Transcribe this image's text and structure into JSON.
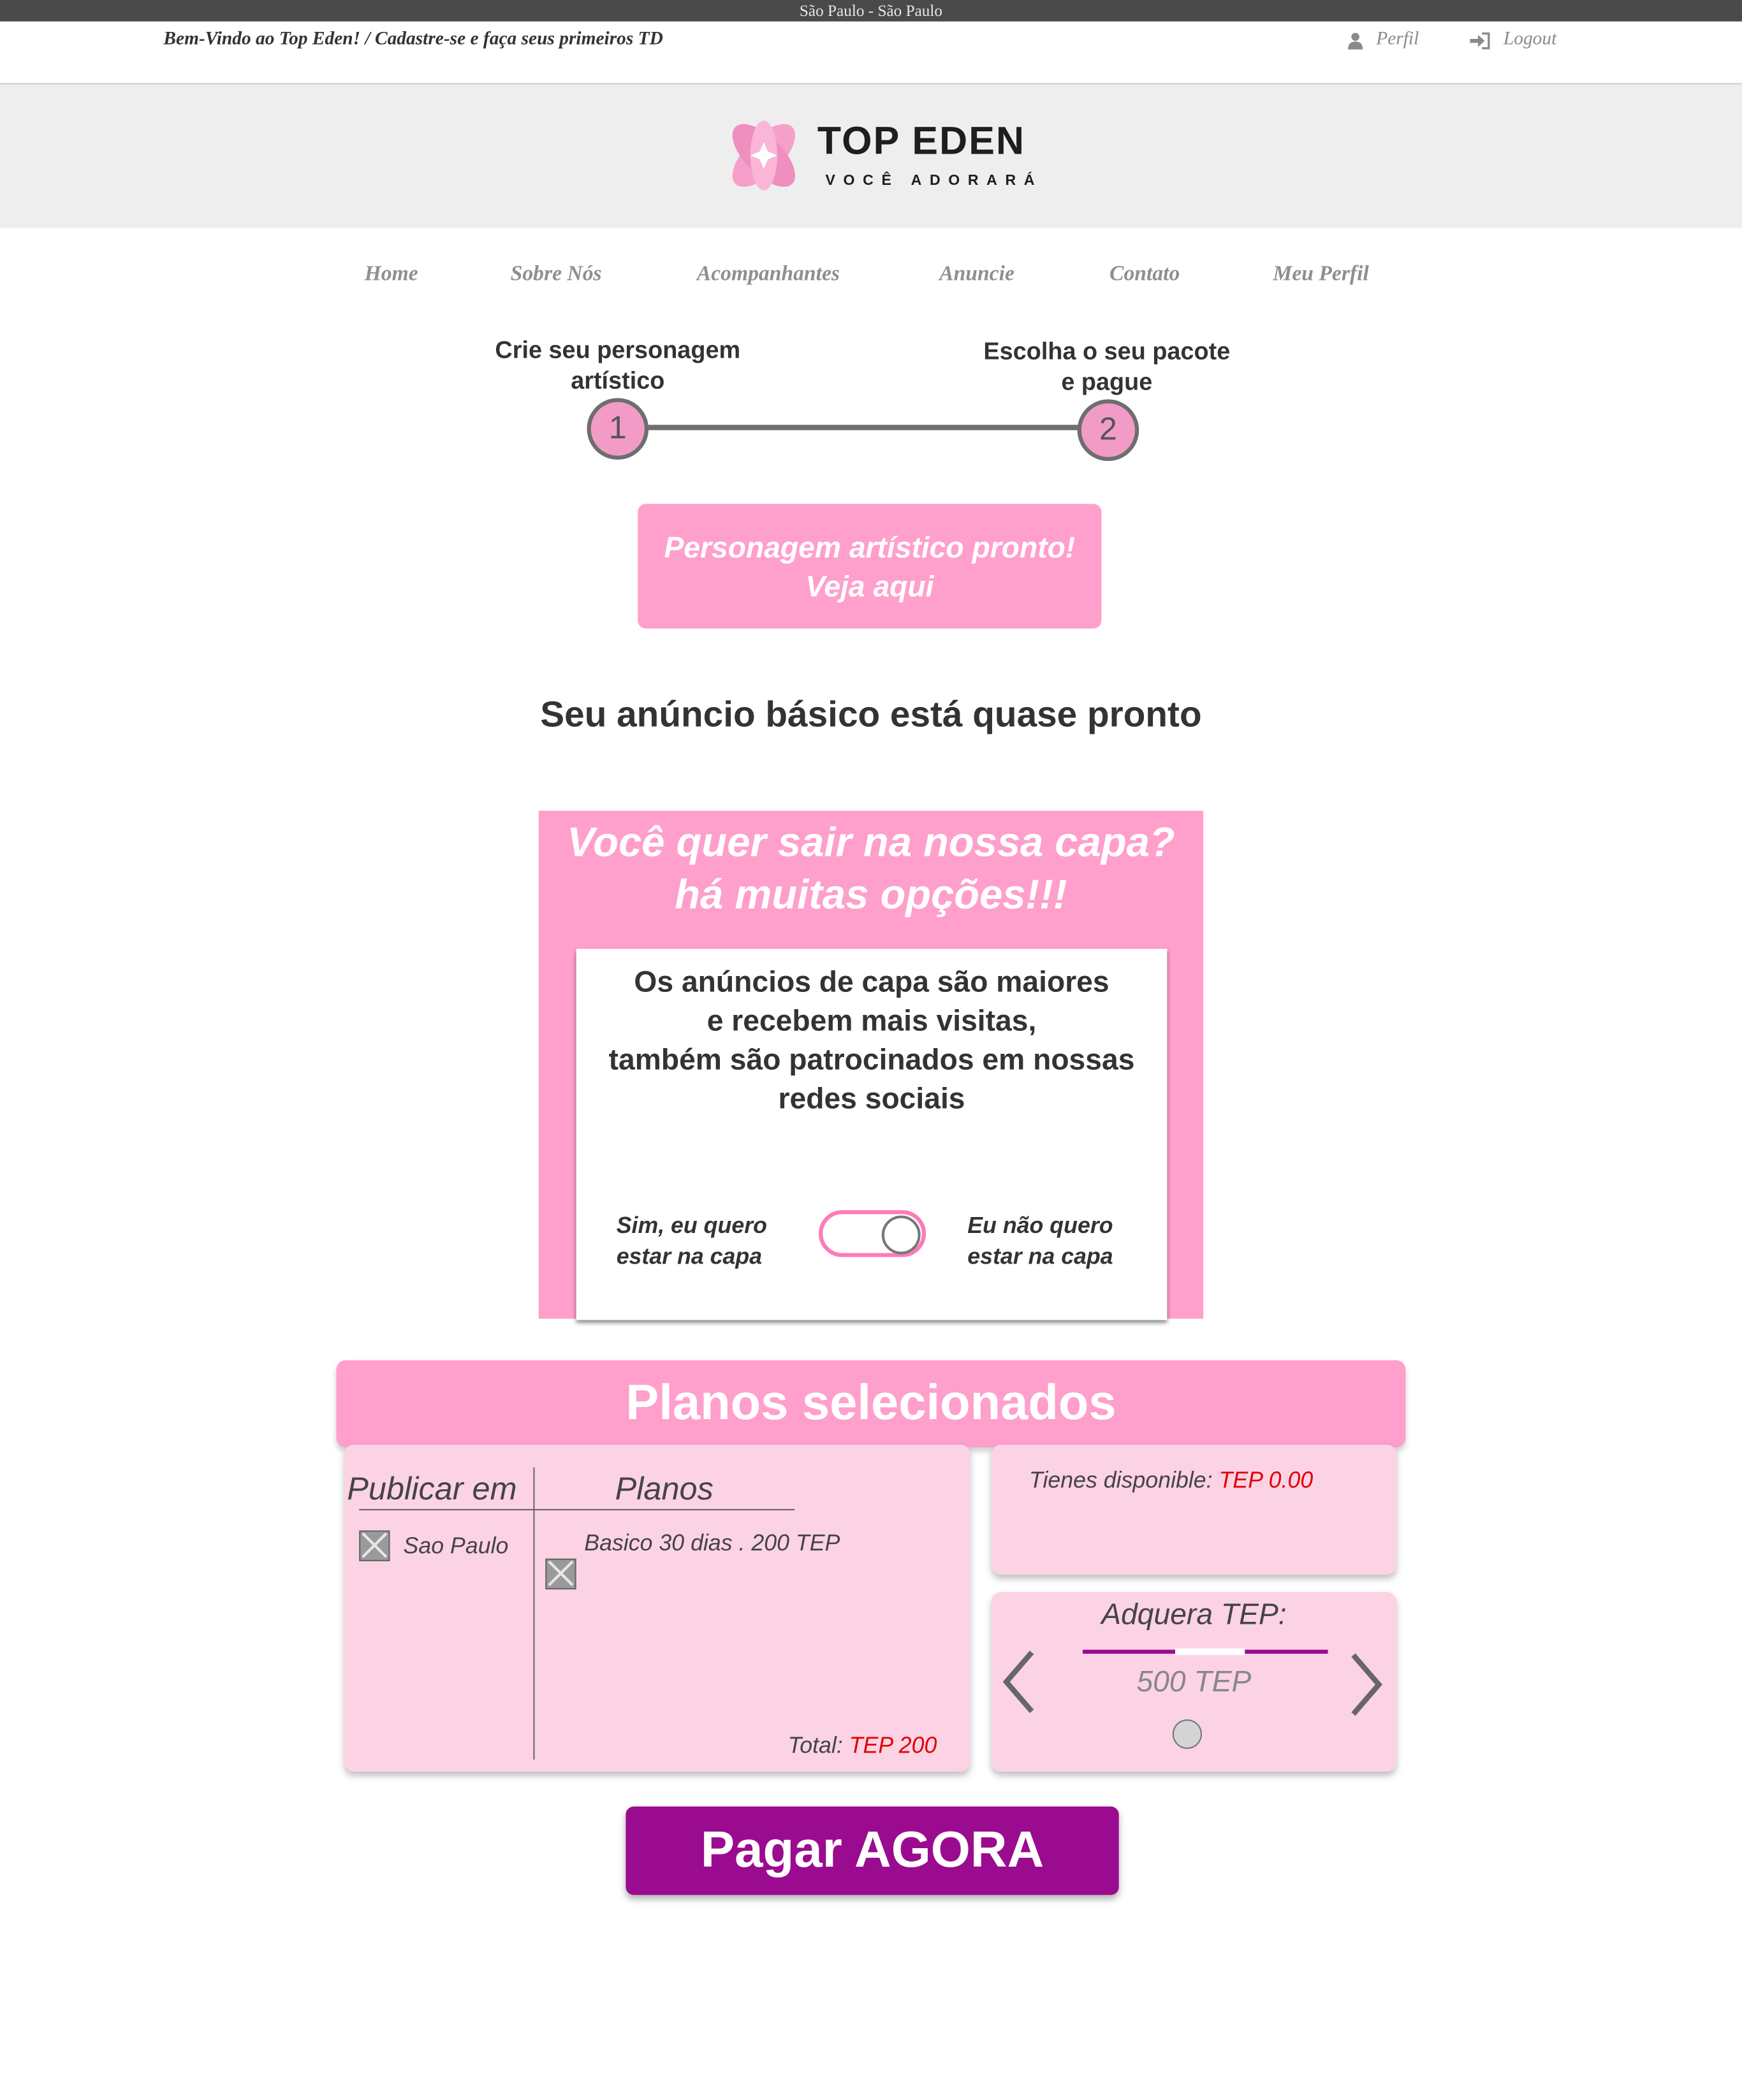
{
  "topbar": {
    "location": "São Paulo - São Paulo"
  },
  "header": {
    "welcome": "Bem-Vindo ao Top Eden! / Cadastre-se e faça seus primeiros TD",
    "perfil_label": "Perfil",
    "logout_label": "Logout"
  },
  "logo": {
    "name": "TOP EDEN",
    "tagline": "VOCÊ ADORARÁ"
  },
  "nav": {
    "items": [
      {
        "label": "Home"
      },
      {
        "label": "Sobre Nós"
      },
      {
        "label": "Acompanhantes"
      },
      {
        "label": "Anuncie"
      },
      {
        "label": "Contato"
      },
      {
        "label": "Meu Perfil"
      }
    ]
  },
  "steps": [
    {
      "number": "1",
      "line1": "Crie seu personagem",
      "line2": "artístico"
    },
    {
      "number": "2",
      "line1": "Escolha o seu pacote",
      "line2": "e pague"
    }
  ],
  "ready_button": {
    "line1": "Personagem artístico pronto!",
    "line2": "Veja aqui"
  },
  "almost_title": "Seu anúncio básico está quase pronto",
  "capa": {
    "title_line1": "Você quer sair na nossa capa?",
    "title_line2": "há muitas opções!!!",
    "desc_line1": "Os anúncios de capa são maiores",
    "desc_line2": "e recebem mais visitas,",
    "desc_line3": "também são patrocinados em nossas",
    "desc_line4": "redes sociais",
    "yes_line1": "Sim, eu quero",
    "yes_line2": "estar na capa",
    "no_line1": "Eu não quero",
    "no_line2": "estar na capa"
  },
  "plans": {
    "header": "Planos selecionados",
    "col_publish": "Publicar em",
    "col_plans": "Planos",
    "publish_item": "Sao Paulo",
    "plan_item": "Basico 30 dias . 200 TEP",
    "total_label": "Total:",
    "total_value": "TEP  200"
  },
  "balance": {
    "label": "Tienes disponible:",
    "value": "TEP 0.00"
  },
  "buy": {
    "title": "Adquera TEP:",
    "amount": "500 TEP"
  },
  "pay_button": "Pagar AGORA",
  "colors": {
    "pink": "#ff9fcb",
    "light_pink": "#fcd3e5",
    "purple": "#9b0b8f",
    "red": "#e00000"
  }
}
